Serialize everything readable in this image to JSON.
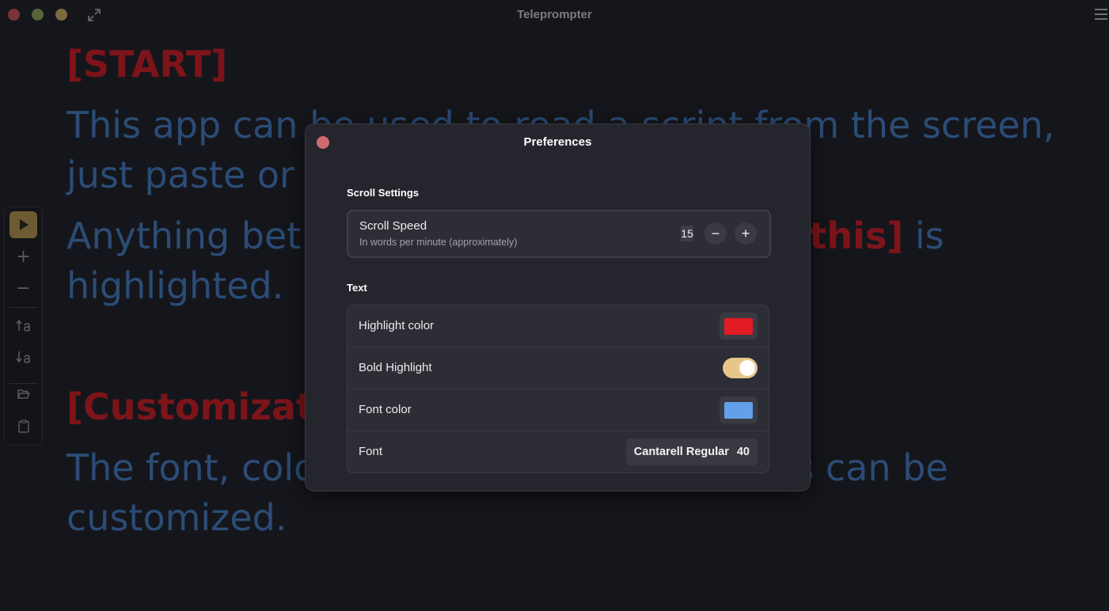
{
  "window": {
    "title": "Teleprompter"
  },
  "script": {
    "highlight_color": "#7c141a",
    "text_color": "#2b4c76",
    "paragraphs": [
      {
        "marker": "[START]"
      },
      {
        "text": "This app can be used to read a script from the screen, just paste or"
      },
      {
        "before": "Anything bet",
        "marker": "this]",
        "after": " is highlighted."
      },
      {
        "marker": "[Customizat"
      },
      {
        "before": "The font, colo",
        "after": "s can be customized."
      }
    ]
  },
  "toolbar": {
    "items": [
      "play-icon",
      "plus-icon",
      "minus-icon",
      "increase-text-size-icon",
      "decrease-text-size-icon",
      "open-folder-icon",
      "clipboard-icon"
    ],
    "plus_glyph": "+",
    "minus_glyph": "−"
  },
  "preferences": {
    "title": "Preferences",
    "scroll_section": {
      "title": "Scroll Settings",
      "speed_label": "Scroll Speed",
      "speed_subtitle": "In words per minute (approximately)",
      "speed_value": "15",
      "minus_glyph": "−",
      "plus_glyph": "+"
    },
    "text_section": {
      "title": "Text",
      "highlight_color_label": "Highlight color",
      "highlight_color_value": "#e01b24",
      "bold_highlight_label": "Bold Highlight",
      "bold_highlight_on": true,
      "font_color_label": "Font color",
      "font_color_value": "#62a0ea",
      "font_label": "Font",
      "font_name": "Cantarell Regular",
      "font_size": "40"
    }
  }
}
